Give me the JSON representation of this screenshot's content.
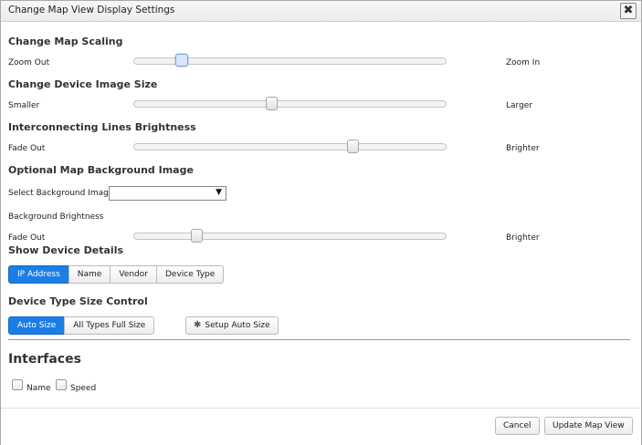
{
  "dialog": {
    "title": "Change Map View Display Settings",
    "close_glyph": "✖"
  },
  "scaling": {
    "heading": "Change Map Scaling",
    "min_label": "Zoom Out",
    "max_label": "Zoom In",
    "value": 0.15
  },
  "device_image": {
    "heading": "Change Device Image Size",
    "min_label": "Smaller",
    "max_label": "Larger",
    "value": 0.44
  },
  "lines": {
    "heading": "Interconnecting Lines Brightness",
    "min_label": "Fade Out",
    "max_label": "Brighter",
    "value": 0.7
  },
  "background": {
    "heading": "Optional Map Background Image",
    "select_label": "Select Background Image",
    "select_value": "",
    "brightness_label": "Background Brightness",
    "min_label": "Fade Out",
    "max_label": "Brighter",
    "value": 0.2
  },
  "device_details": {
    "heading": "Show Device Details",
    "options": [
      "IP Address",
      "Name",
      "Vendor",
      "Device Type"
    ],
    "selected": "IP Address"
  },
  "size_control": {
    "heading": "Device Type Size Control",
    "options": [
      "Auto Size",
      "All Types Full Size"
    ],
    "selected": "Auto Size",
    "setup_label": "Setup Auto Size"
  },
  "interfaces": {
    "heading": "Interfaces",
    "name_label": "Name",
    "speed_label": "Speed"
  },
  "footer": {
    "cancel_label": "Cancel",
    "update_label": "Update Map View"
  }
}
